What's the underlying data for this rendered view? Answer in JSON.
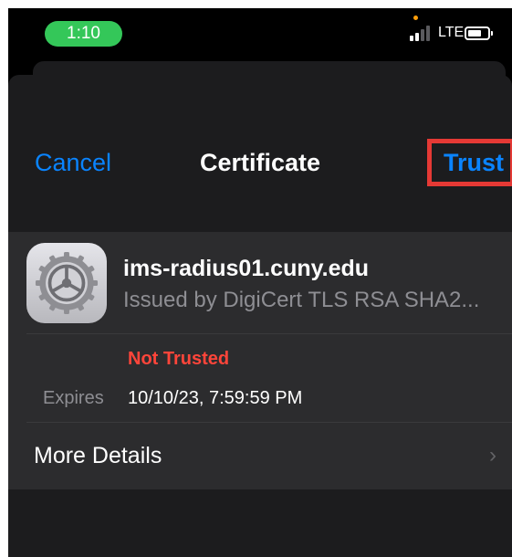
{
  "status_bar": {
    "time": "1:10",
    "network": "LTE"
  },
  "nav": {
    "cancel_label": "Cancel",
    "title": "Certificate",
    "trust_label": "Trust"
  },
  "certificate": {
    "name": "ims-radius01.cuny.edu",
    "issuer": "Issued by DigiCert TLS RSA SHA2...",
    "status": "Not Trusted",
    "expires_label": "Expires",
    "expires_value": "10/10/23, 7:59:59 PM"
  },
  "more_details": {
    "label": "More Details",
    "chevron": "›"
  },
  "icons": {
    "settings": "gear-icon",
    "signal": "cellular-signal-icon",
    "battery": "battery-icon",
    "chevron": "chevron-right-icon"
  },
  "colors": {
    "accent": "#0a84ff",
    "status_pill": "#34c759",
    "not_trusted": "#ff453a",
    "highlight_box": "#e53935"
  }
}
